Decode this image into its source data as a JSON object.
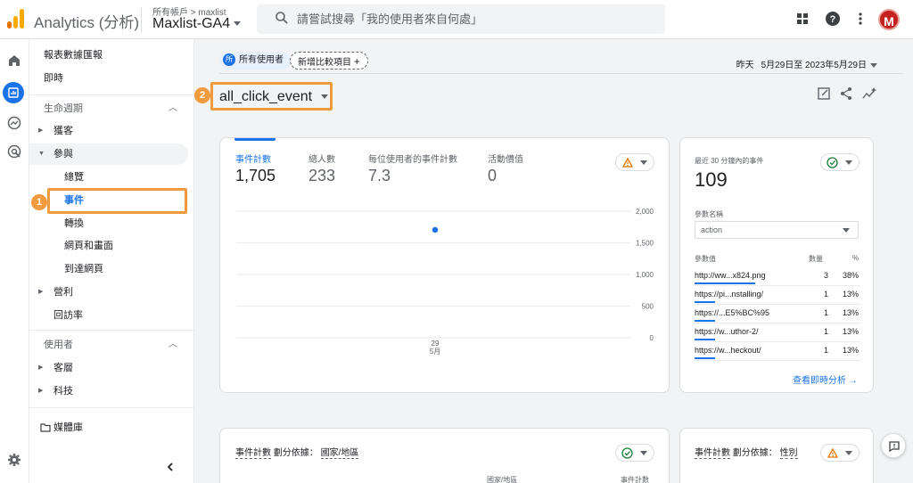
{
  "header": {
    "app_title": "Analytics (分析)",
    "account_crumb": "所有帳戶 > maxlist",
    "property_name": "Maxlist-GA4",
    "search_placeholder": "請嘗試搜尋「我的使用者來自何處」",
    "avatar_letter": "M",
    "icons": [
      "apps-grid-icon",
      "help-icon",
      "more-vert-icon"
    ]
  },
  "rail": {
    "icons": [
      "home-icon",
      "reports-icon",
      "explore-icon",
      "advertising-icon",
      "settings-icon"
    ]
  },
  "nav": {
    "title": "報表數據匯報",
    "realtime": "即時",
    "lifecycle": "生命週期",
    "acquisition": "獲客",
    "engagement": "參與",
    "overview": "總覽",
    "events": "事件",
    "conversions": "轉換",
    "pages": "網頁和畫面",
    "landing": "到達網頁",
    "monetization": "營利",
    "retention": "回訪率",
    "users_section": "使用者",
    "demographics": "客層",
    "tech": "科技",
    "library": "媒體庫",
    "step1": "1"
  },
  "toolbar": {
    "segment_badge": "所",
    "segment_chip": "所有使用者",
    "add_comparison": "新增比較項目",
    "date_prefix": "昨天",
    "date_range": "5月29日至 2023年5月29日",
    "report_title": "all_click_event",
    "step2": "2"
  },
  "metrics": [
    {
      "label": "事件計數",
      "value": "1,705"
    },
    {
      "label": "總人數",
      "value": "233"
    },
    {
      "label": "每位使用者的事件計數",
      "value": "7.3"
    },
    {
      "label": "活動價值",
      "value": "0"
    }
  ],
  "chart_data": {
    "type": "scatter",
    "x": [
      "29 5月"
    ],
    "series": [
      {
        "values": [
          1705
        ]
      }
    ],
    "yticks": [
      "2,000",
      "1,500",
      "1,000",
      "500",
      "0"
    ],
    "ylim": [
      0,
      2000
    ],
    "xtick_day": "29",
    "xtick_month": "5月",
    "grid": true
  },
  "realtime": {
    "title": "最近 30 分鐘內的事件",
    "count": "109",
    "param_label": "參數名稱",
    "param_value": "action",
    "col_value": "參數值",
    "col_count": "數量",
    "col_pct": "%",
    "rows": [
      {
        "value": "http://ww...x824.png",
        "count": "3",
        "pct": "38%",
        "share": 0.38
      },
      {
        "value": "https://pi...nstalling/",
        "count": "1",
        "pct": "13%",
        "share": 0.13
      },
      {
        "value": "https://...E5%BC%95",
        "count": "1",
        "pct": "13%",
        "share": 0.13
      },
      {
        "value": "https://w...uthor-2/",
        "count": "1",
        "pct": "13%",
        "share": 0.13
      },
      {
        "value": "https://w...heckout/",
        "count": "1",
        "pct": "13%",
        "share": 0.13
      }
    ],
    "link": "查看即時分析 →"
  },
  "bottom": {
    "card1_title_a": "事件計數",
    "card1_title_b": "劃分依據：",
    "card1_title_c": "國家/地區",
    "col_country": "國家/地區",
    "col_events": "事件計數",
    "card2_title_a": "事件計數",
    "card2_title_b": "劃分依據：",
    "card2_title_c": "性別"
  },
  "colors": {
    "accent": "#1a73e8",
    "highlight": "#f29a3e",
    "warning": "#e37400",
    "success": "#188038"
  }
}
